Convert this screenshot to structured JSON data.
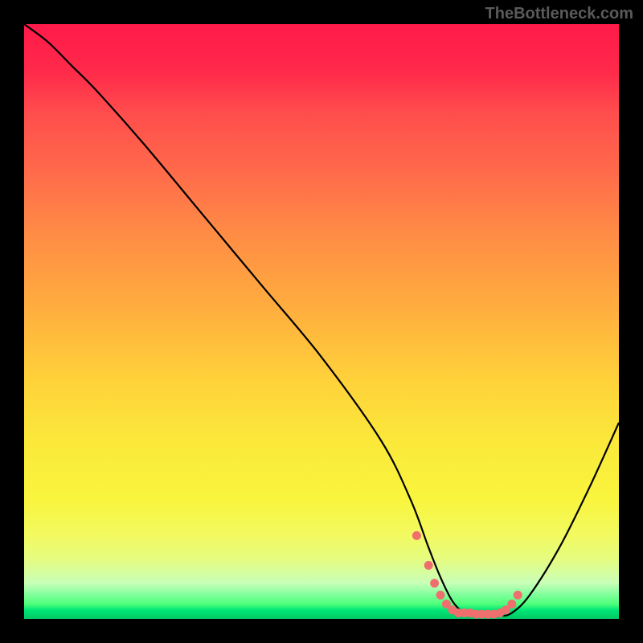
{
  "watermark": "TheBottleneck.com",
  "chart_data": {
    "type": "line",
    "title": "",
    "xlabel": "",
    "ylabel": "",
    "xlim": [
      0,
      100
    ],
    "ylim": [
      0,
      100
    ],
    "grid": false,
    "legend": false,
    "background": {
      "type": "vertical-gradient",
      "stops": [
        {
          "pos": 0,
          "color": "#ff1a4a"
        },
        {
          "pos": 50,
          "color": "#ffc23c"
        },
        {
          "pos": 80,
          "color": "#f9f53e"
        },
        {
          "pos": 100,
          "color": "#00c864"
        }
      ]
    },
    "series": [
      {
        "name": "bottleneck-curve",
        "x": [
          0,
          4,
          8,
          12,
          20,
          30,
          40,
          50,
          60,
          65,
          68,
          70,
          72,
          74,
          76,
          78,
          80,
          82,
          85,
          90,
          95,
          100
        ],
        "values": [
          100,
          97,
          93,
          89,
          80,
          68,
          56,
          44,
          30,
          20,
          12,
          7,
          3,
          1,
          0.5,
          0.5,
          0.5,
          1,
          4,
          12,
          22,
          33
        ]
      }
    ],
    "optimal_markers": {
      "name": "optimal-zone",
      "x": [
        66,
        68,
        69,
        70,
        71,
        72,
        73,
        74,
        75,
        76,
        77,
        78,
        79,
        80,
        81,
        82,
        83
      ],
      "values": [
        14,
        9,
        6,
        4,
        2.5,
        1.5,
        1,
        1,
        1,
        0.8,
        0.8,
        0.8,
        0.8,
        1,
        1.5,
        2.5,
        4
      ]
    }
  }
}
